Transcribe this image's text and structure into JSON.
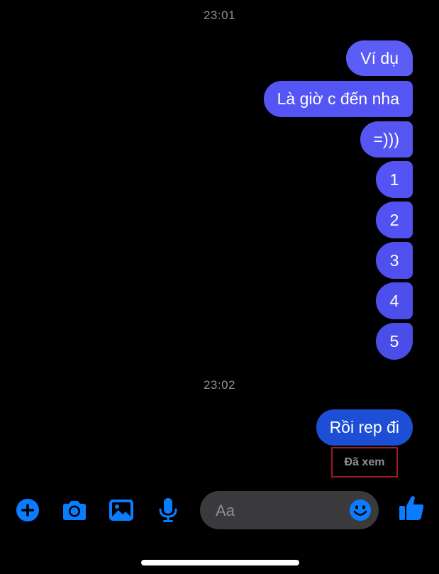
{
  "conversation": {
    "timestamp_1": "23:01",
    "messages_group_1": [
      "Ví dụ",
      "Là giờ c đến nha",
      "=)))",
      "1",
      "2",
      "3",
      "4",
      "5"
    ],
    "timestamp_2": "23:02",
    "messages_group_2": [
      "Rồi rep đi"
    ],
    "seen_status": "Đã xem"
  },
  "composer": {
    "placeholder": "Aa"
  },
  "toolbar": {
    "icons": [
      "plus-icon",
      "camera-icon",
      "image-icon",
      "microphone-icon",
      "emoji-icon",
      "thumbs-up-icon"
    ]
  },
  "colors": {
    "accent": "#0a7cff",
    "bubble_purple": "#5555f5",
    "bubble_blue": "#1d4fd6",
    "background": "#000000"
  }
}
